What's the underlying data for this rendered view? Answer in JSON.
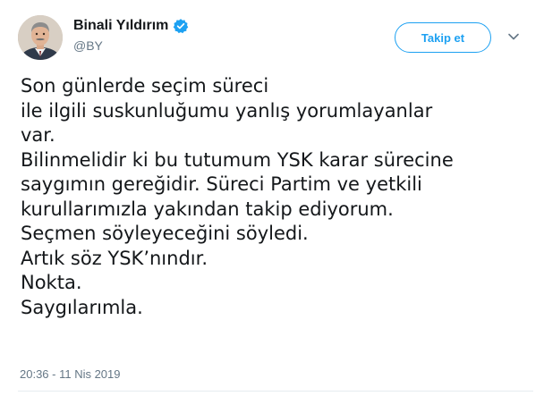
{
  "author": {
    "display_name": "Binali Yıldırım",
    "handle": "@BY",
    "verified": true
  },
  "actions": {
    "follow_label": "Takip et",
    "menu_icon": "chevron-down-icon"
  },
  "tweet": {
    "lines": [
      "Son günlerde seçim süreci",
      "ile ilgili suskunluğumu yanlış yorumlayanlar",
      "var.",
      "Bilinmelidir ki bu tutumum YSK karar sürecine",
      "saygımın gereğidir. Süreci Partim ve yetkili",
      "kurullarımızla yakından takip ediyorum.",
      "Seçmen söyleyeceğini söyledi.",
      "Artık söz YSK’nındır.",
      "Nokta.",
      "Saygılarımla."
    ],
    "timestamp": "20:36 - 11 Nis 2019"
  },
  "colors": {
    "accent": "#1da1f2",
    "text": "#14171a",
    "secondary_text": "#657786",
    "divider": "#e6ecf0"
  }
}
